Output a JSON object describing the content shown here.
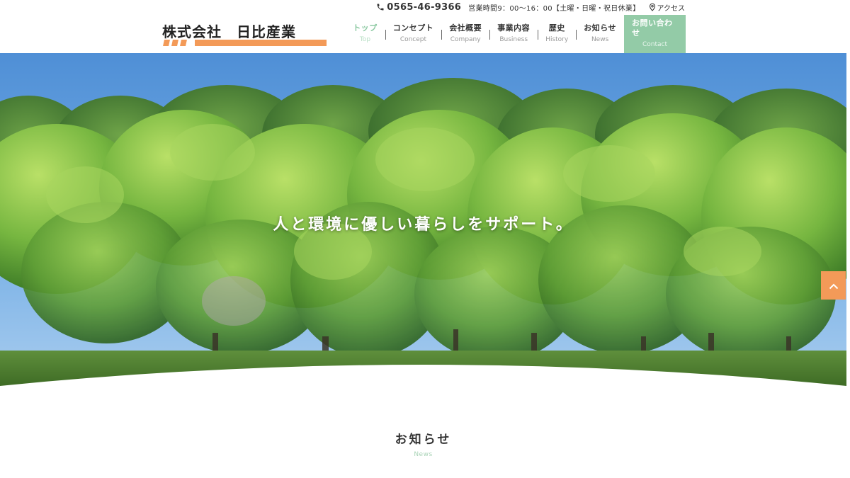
{
  "logo": {
    "text": "株式会社　日比産業"
  },
  "topbar": {
    "phone": "0565-46-9366",
    "hours": "営業時間9：00〜16：00【土曜・日曜・祝日休業】",
    "access": "アクセス"
  },
  "nav": {
    "items": [
      {
        "ja": "トップ",
        "en": "Top"
      },
      {
        "ja": "コンセプト",
        "en": "Concept"
      },
      {
        "ja": "会社概要",
        "en": "Company"
      },
      {
        "ja": "事業内容",
        "en": "Business"
      },
      {
        "ja": "歴史",
        "en": "History"
      },
      {
        "ja": "お知らせ",
        "en": "News"
      }
    ],
    "contact": {
      "ja": "お問い合わせ",
      "en": "Contact"
    }
  },
  "hero": {
    "title": "人と環境に優しい暮らしをサポート。"
  },
  "news": {
    "title": "お知らせ",
    "subtitle": "News"
  },
  "colors": {
    "accent_orange": "#f39a58",
    "accent_green": "#93cba7",
    "active_green": "#8ac8a0"
  },
  "icons": {
    "phone": "phone-icon",
    "access": "map-pin-icon",
    "to_top": "chevron-up-icon"
  }
}
